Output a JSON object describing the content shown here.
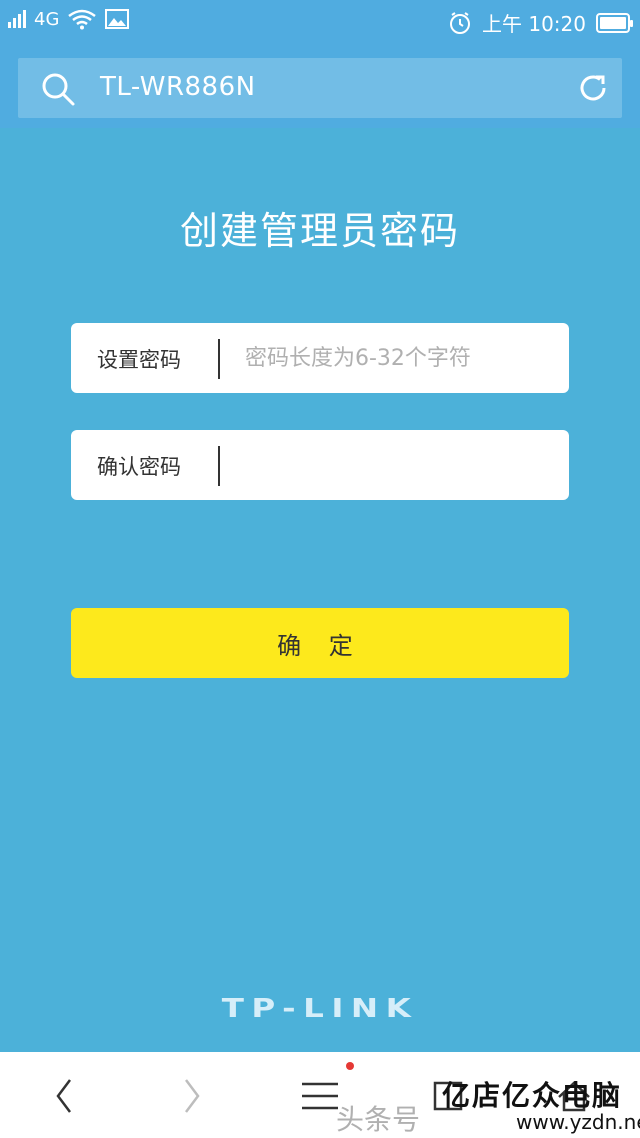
{
  "status_bar": {
    "network": "4G",
    "time": "上午 10:20"
  },
  "address_bar": {
    "url": "TL-WR886N"
  },
  "page": {
    "title": "创建管理员密码",
    "set_password_label": "设置密码",
    "set_password_placeholder": "密码长度为6-32个字符",
    "set_password_value": "",
    "confirm_password_label": "确认密码",
    "confirm_password_value": "",
    "confirm_button": "确 定",
    "brand_logo": "TP-LINK"
  },
  "watermark": {
    "toutiao": "头条号",
    "site_name": "亿店亿众电脑",
    "site_url": "www.yzdn.net"
  },
  "icons": [
    "signal-icon",
    "wifi-icon",
    "image-icon",
    "alarm-icon",
    "battery-icon",
    "search-icon",
    "refresh-icon",
    "back-icon",
    "forward-icon",
    "menu-icon",
    "tabs-icon",
    "home-icon"
  ],
  "colors": {
    "background": "#4cb1d9",
    "toolbar": "#50ace0",
    "button": "#fde91c"
  }
}
